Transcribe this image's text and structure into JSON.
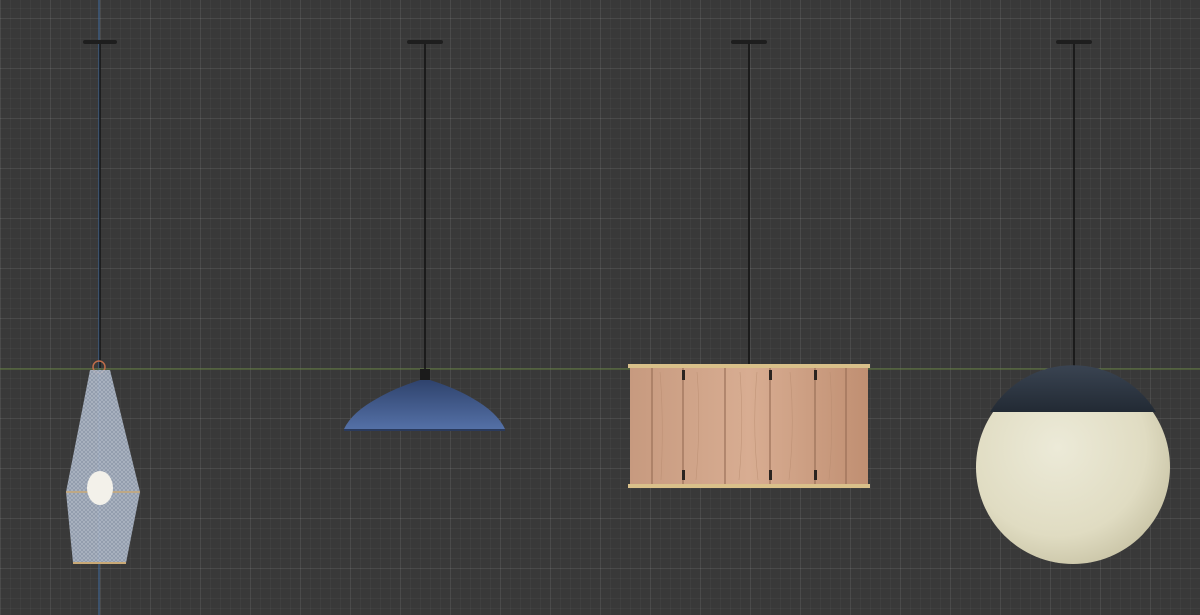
{
  "viewport": {
    "background_color": "#393939",
    "grid_color": "#454545",
    "horizon_axis_color": "#5f7a3a",
    "vertical_axis_color": "#3f6aa0"
  },
  "lamps": [
    {
      "name": "lamp-mesh-lantern",
      "shade_color": "#a8b4c6"
    },
    {
      "name": "lamp-blue-dome",
      "shade_color": "#4a6292"
    },
    {
      "name": "lamp-wooden-drum",
      "shade_color": "#c89a80"
    },
    {
      "name": "lamp-glass-globe",
      "shade_color": "#e3e0c8",
      "cap_color": "#2c3440"
    }
  ]
}
